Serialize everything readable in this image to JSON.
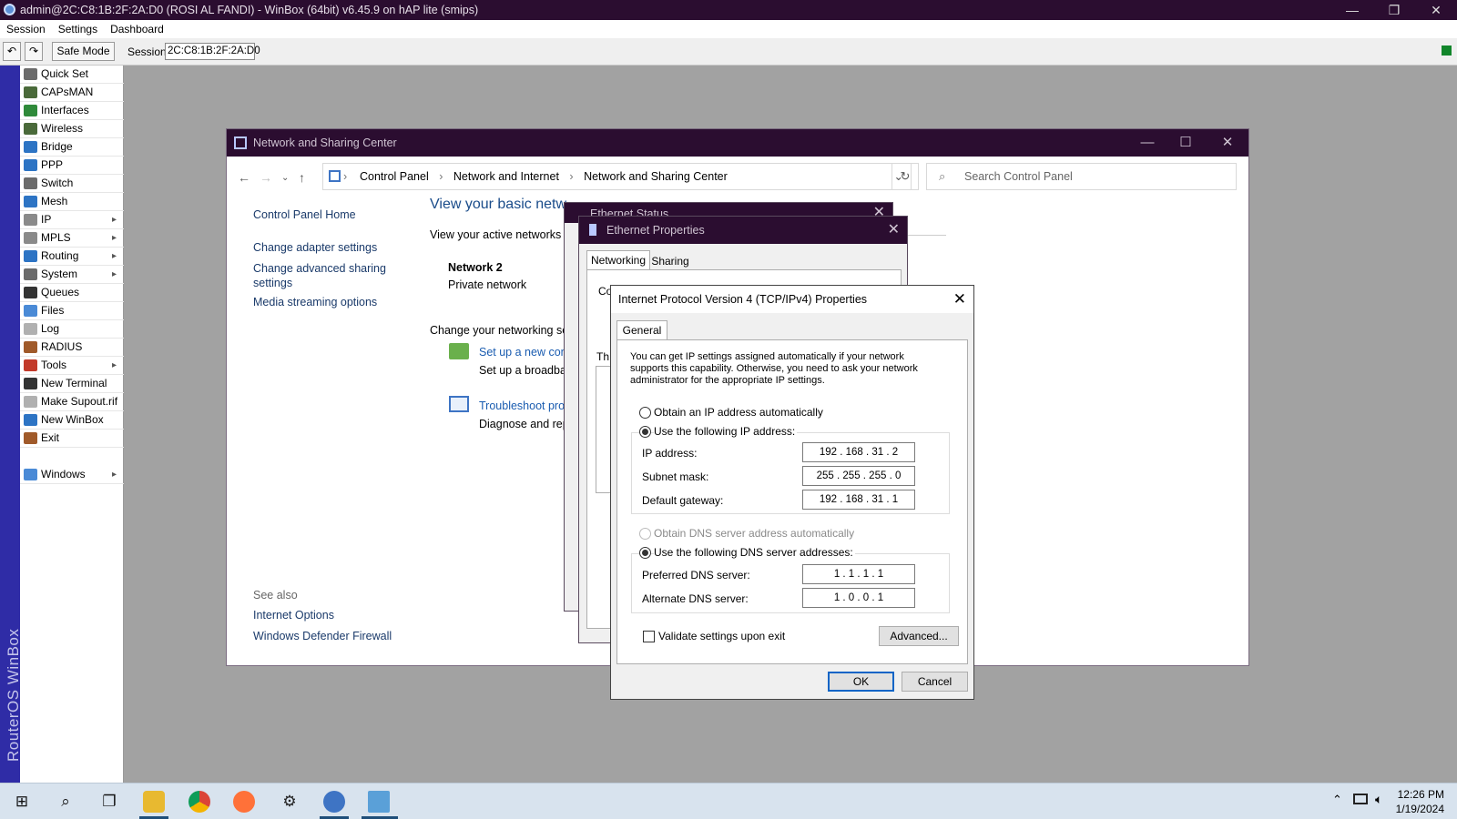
{
  "winbox": {
    "title": "admin@2C:C8:1B:2F:2A:D0 (ROSI AL FANDI) - WinBox (64bit) v6.45.9 on hAP lite (smips)",
    "menu": [
      "Session",
      "Settings",
      "Dashboard"
    ],
    "toolbar": {
      "safe_mode": "Safe Mode",
      "session_label": "Session:",
      "session_value": "2C:C8:1B:2F:2A:D0"
    },
    "vertical_label": "RouterOS WinBox",
    "nav": [
      {
        "label": "Quick Set",
        "icon": "quick-set-icon",
        "color": "#6b6b6b",
        "arrow": false
      },
      {
        "label": "CAPsMAN",
        "icon": "antenna-icon",
        "color": "#4a6a3a",
        "arrow": false
      },
      {
        "label": "Interfaces",
        "icon": "interfaces-icon",
        "color": "#2f8a3a",
        "arrow": false
      },
      {
        "label": "Wireless",
        "icon": "wireless-icon",
        "color": "#4a6a3a",
        "arrow": false
      },
      {
        "label": "Bridge",
        "icon": "bridge-icon",
        "color": "#2d74c4",
        "arrow": false
      },
      {
        "label": "PPP",
        "icon": "ppp-icon",
        "color": "#2d74c4",
        "arrow": false
      },
      {
        "label": "Switch",
        "icon": "switch-icon",
        "color": "#6b6b6b",
        "arrow": false
      },
      {
        "label": "Mesh",
        "icon": "mesh-icon",
        "color": "#2d74c4",
        "arrow": false
      },
      {
        "label": "IP",
        "icon": "ip-icon",
        "color": "#8a8a8a",
        "arrow": true
      },
      {
        "label": "MPLS",
        "icon": "mpls-icon",
        "color": "#8a8a8a",
        "arrow": true
      },
      {
        "label": "Routing",
        "icon": "routing-icon",
        "color": "#2d74c4",
        "arrow": true
      },
      {
        "label": "System",
        "icon": "system-icon",
        "color": "#6b6b6b",
        "arrow": true
      },
      {
        "label": "Queues",
        "icon": "queues-icon",
        "color": "#333333",
        "arrow": false
      },
      {
        "label": "Files",
        "icon": "files-icon",
        "color": "#4a8ad6",
        "arrow": false
      },
      {
        "label": "Log",
        "icon": "log-icon",
        "color": "#b0b0b0",
        "arrow": false
      },
      {
        "label": "RADIUS",
        "icon": "radius-icon",
        "color": "#a05a2a",
        "arrow": false
      },
      {
        "label": "Tools",
        "icon": "tools-icon",
        "color": "#c23a2a",
        "arrow": true
      },
      {
        "label": "New Terminal",
        "icon": "terminal-icon",
        "color": "#333333",
        "arrow": false
      },
      {
        "label": "Make Supout.rif",
        "icon": "supout-icon",
        "color": "#b0b0b0",
        "arrow": false
      },
      {
        "label": "New WinBox",
        "icon": "winbox-icon",
        "color": "#2d74c4",
        "arrow": false
      },
      {
        "label": "Exit",
        "icon": "exit-icon",
        "color": "#a05a2a",
        "arrow": false
      },
      {
        "label": "Windows",
        "icon": "windows-icon",
        "color": "#4a8ad6",
        "arrow": true
      }
    ]
  },
  "control_panel": {
    "title": "Network and Sharing Center",
    "breadcrumb": [
      "Control Panel",
      "Network and Internet",
      "Network and Sharing Center"
    ],
    "search_placeholder": "Search Control Panel",
    "left_links": [
      "Control Panel Home",
      "Change adapter settings",
      "Change advanced sharing settings",
      "Media streaming options"
    ],
    "see_also": "See also",
    "see_also_links": [
      "Internet Options",
      "Windows Defender Firewall"
    ],
    "heading": "View your basic netw",
    "active_networks": "View your active networks",
    "network_name": "Network 2",
    "network_type": "Private network",
    "change_settings": "Change your networking set",
    "setup_link": "Set up a new conn",
    "setup_desc": "Set up a broadbar",
    "troubleshoot_link": "Troubleshoot prob",
    "troubleshoot_desc": "Diagnose and rep"
  },
  "ethernet_status": {
    "title": "Ethernet Status"
  },
  "ethernet_props": {
    "title": "Ethernet Properties",
    "tabs": [
      "Networking",
      "Sharing"
    ],
    "frag_connect": "Co",
    "frag_this": "Th",
    "frag_d": "D"
  },
  "ipv4": {
    "title": "Internet Protocol Version 4 (TCP/IPv4) Properties",
    "tab": "General",
    "intro": "You can get IP settings assigned automatically if your network supports this capability. Otherwise, you need to ask your network administrator for the appropriate IP settings.",
    "auto_ip": "Obtain an IP address automatically",
    "manual_ip": "Use the following IP address:",
    "ip_label": "IP address:",
    "ip_value": "192 . 168 . 31 . 2",
    "mask_label": "Subnet mask:",
    "mask_value": "255 . 255 . 255 . 0",
    "gw_label": "Default gateway:",
    "gw_value": "192 . 168 . 31 . 1",
    "auto_dns": "Obtain DNS server address automatically",
    "manual_dns": "Use the following DNS server addresses:",
    "pref_label": "Preferred DNS server:",
    "pref_value": "1 . 1 . 1 . 1",
    "alt_label": "Alternate DNS server:",
    "alt_value": "1 . 0 . 0 . 1",
    "validate": "Validate settings upon exit",
    "advanced": "Advanced...",
    "ok": "OK",
    "cancel": "Cancel"
  },
  "taskbar": {
    "time": "12:26 PM",
    "date": "1/19/2024"
  }
}
